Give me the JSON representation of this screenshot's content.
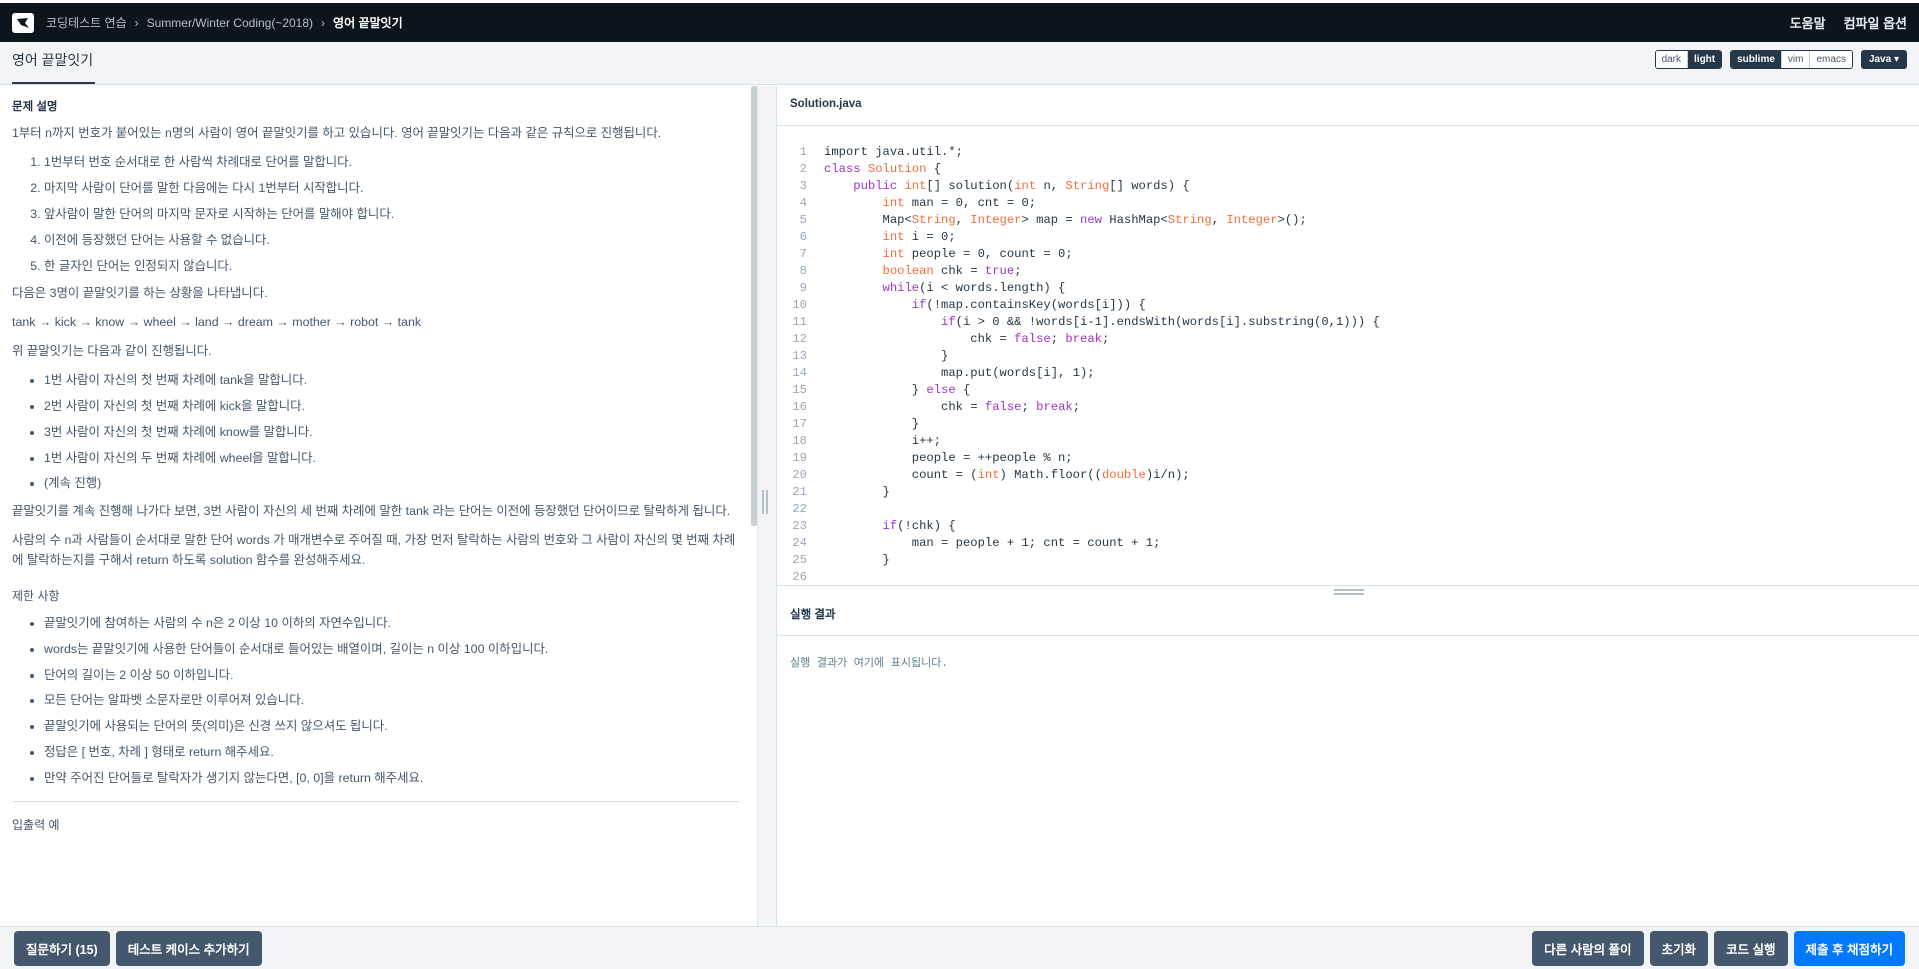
{
  "header": {
    "breadcrumb": [
      "코딩테스트 연습",
      "Summer/Winter Coding(~2018)",
      "영어 끝말잇기"
    ],
    "help": "도움말",
    "compile_options": "컴파일 옵션"
  },
  "subheader": {
    "tab": "영어 끝말잇기",
    "themes": [
      "dark",
      "light"
    ],
    "keymaps": [
      "sublime",
      "vim",
      "emacs"
    ],
    "language": "Java"
  },
  "problem": {
    "desc_title": "문제 설명",
    "intro": "1부터 n까지 번호가 붙어있는 n명의 사람이 영어 끝말잇기를 하고 있습니다. 영어 끝말잇기는 다음과 같은 규칙으로 진행됩니다.",
    "rules": [
      "1번부터 번호 순서대로 한 사람씩 차례대로 단어를 말합니다.",
      "마지막 사람이 단어를 말한 다음에는 다시 1번부터 시작합니다.",
      "앞사람이 말한 단어의 마지막 문자로 시작하는 단어를 말해야 합니다.",
      "이전에 등장했던 단어는 사용할 수 없습니다.",
      "한 글자인 단어는 인정되지 않습니다."
    ],
    "example_intro": "다음은 3명이 끝말잇기를 하는 상황을 나타냅니다.",
    "example_chain": "tank → kick → know → wheel → land → dream → mother → robot → tank",
    "progress_intro": "위 끝말잇기는 다음과 같이 진행됩니다.",
    "progress": [
      "1번 사람이 자신의 첫 번째 차례에 tank을 말합니다.",
      "2번 사람이 자신의 첫 번째 차례에 kick을 말합니다.",
      "3번 사람이 자신의 첫 번째 차례에 know를 말합니다.",
      "1번 사람이 자신의 두 번째 차례에 wheel을 말합니다.",
      "(계속 진행)"
    ],
    "para1": "끝말잇기를 계속 진행해 나가다 보면, 3번 사람이 자신의 세 번째 차례에 말한 tank 라는 단어는 이전에 등장했던 단어이므로 탈락하게 됩니다.",
    "para2": "사람의 수 n과 사람들이 순서대로 말한 단어 words 가 매개변수로 주어질 때, 가장 먼저 탈락하는 사람의 번호와 그 사람이 자신의 몇 번째 차례에 탈락하는지를 구해서 return 하도록 solution 함수를 완성해주세요.",
    "constraints_title": "제한 사항",
    "constraints": [
      "끝말잇기에 참여하는 사람의 수 n은 2 이상 10 이하의 자연수입니다.",
      "words는 끝말잇기에 사용한 단어들이 순서대로 들어있는 배열이며, 길이는 n 이상 100 이하입니다.",
      "단어의 길이는 2 이상 50 이하입니다.",
      "모든 단어는 알파벳 소문자로만 이루어져 있습니다.",
      "끝말잇기에 사용되는 단어의 뜻(의미)은 신경 쓰지 않으셔도 됩니다.",
      "정답은 [ 번호, 차례 ] 형태로 return 해주세요.",
      "만약 주어진 단어들로 탈락자가 생기지 않는다면, [0, 0]을 return 해주세요."
    ],
    "io_title": "입출력 예"
  },
  "editor": {
    "filename": "Solution.java",
    "lines": [
      [
        [
          "p",
          "import java.util.*;"
        ]
      ],
      [
        [
          "k",
          "class "
        ],
        [
          "t",
          "Solution"
        ],
        [
          "p",
          " {"
        ]
      ],
      [
        [
          "p",
          "    "
        ],
        [
          "k",
          "public "
        ],
        [
          "t",
          "int"
        ],
        [
          "p",
          "[] solution("
        ],
        [
          "t",
          "int"
        ],
        [
          "p",
          " n, "
        ],
        [
          "t",
          "String"
        ],
        [
          "p",
          "[] words) {"
        ]
      ],
      [
        [
          "p",
          "        "
        ],
        [
          "t",
          "int"
        ],
        [
          "p",
          " man = 0, cnt = 0;"
        ]
      ],
      [
        [
          "p",
          "        Map<"
        ],
        [
          "t",
          "String"
        ],
        [
          "p",
          ", "
        ],
        [
          "t",
          "Integer"
        ],
        [
          "p",
          "> map = "
        ],
        [
          "k",
          "new"
        ],
        [
          "p",
          " HashMap<"
        ],
        [
          "t",
          "String"
        ],
        [
          "p",
          ", "
        ],
        [
          "t",
          "Integer"
        ],
        [
          "p",
          ">();"
        ]
      ],
      [
        [
          "p",
          "        "
        ],
        [
          "t",
          "int"
        ],
        [
          "p",
          " i = 0;"
        ]
      ],
      [
        [
          "p",
          "        "
        ],
        [
          "t",
          "int"
        ],
        [
          "p",
          " people = 0, count = 0;"
        ]
      ],
      [
        [
          "p",
          "        "
        ],
        [
          "t",
          "boolean"
        ],
        [
          "p",
          " chk = "
        ],
        [
          "k",
          "true"
        ],
        [
          "p",
          ";"
        ]
      ],
      [
        [
          "p",
          "        "
        ],
        [
          "k",
          "while"
        ],
        [
          "p",
          "(i < words.length) {"
        ]
      ],
      [
        [
          "p",
          "            "
        ],
        [
          "k",
          "if"
        ],
        [
          "p",
          "(!map.containsKey(words[i])) {"
        ]
      ],
      [
        [
          "p",
          "                "
        ],
        [
          "k",
          "if"
        ],
        [
          "p",
          "(i > 0 && !words[i-1].endsWith(words[i].substring(0,1))) {"
        ]
      ],
      [
        [
          "p",
          "                    chk = "
        ],
        [
          "k",
          "false"
        ],
        [
          "p",
          "; "
        ],
        [
          "k",
          "break"
        ],
        [
          "p",
          ";"
        ]
      ],
      [
        [
          "p",
          "                }"
        ]
      ],
      [
        [
          "p",
          "                map.put(words[i], 1);"
        ]
      ],
      [
        [
          "p",
          "            } "
        ],
        [
          "k",
          "else"
        ],
        [
          "p",
          " {"
        ]
      ],
      [
        [
          "p",
          "                chk = "
        ],
        [
          "k",
          "false"
        ],
        [
          "p",
          "; "
        ],
        [
          "k",
          "break"
        ],
        [
          "p",
          ";"
        ]
      ],
      [
        [
          "p",
          "            }"
        ]
      ],
      [
        [
          "p",
          "            i++;"
        ]
      ],
      [
        [
          "p",
          "            people = ++people % n;"
        ]
      ],
      [
        [
          "p",
          "            count = ("
        ],
        [
          "t",
          "int"
        ],
        [
          "p",
          ") Math.floor(("
        ],
        [
          "t",
          "double"
        ],
        [
          "p",
          ")i/n);"
        ]
      ],
      [
        [
          "p",
          "        }"
        ]
      ],
      [
        [
          "p",
          ""
        ]
      ],
      [
        [
          "p",
          "        "
        ],
        [
          "k",
          "if"
        ],
        [
          "p",
          "(!chk) {"
        ]
      ],
      [
        [
          "p",
          "            man = people + 1; cnt = count + 1;"
        ]
      ],
      [
        [
          "p",
          "        }"
        ]
      ],
      [
        [
          "p",
          ""
        ]
      ]
    ]
  },
  "results": {
    "title": "실행 결과",
    "placeholder": "실행 결과가 여기에 표시됩니다."
  },
  "footer": {
    "ask": "질문하기 (15)",
    "add_testcase": "테스트 케이스 추가하기",
    "others": "다른 사람의 풀이",
    "reset": "초기화",
    "run": "코드 실행",
    "submit": "제출 후 채점하기"
  }
}
